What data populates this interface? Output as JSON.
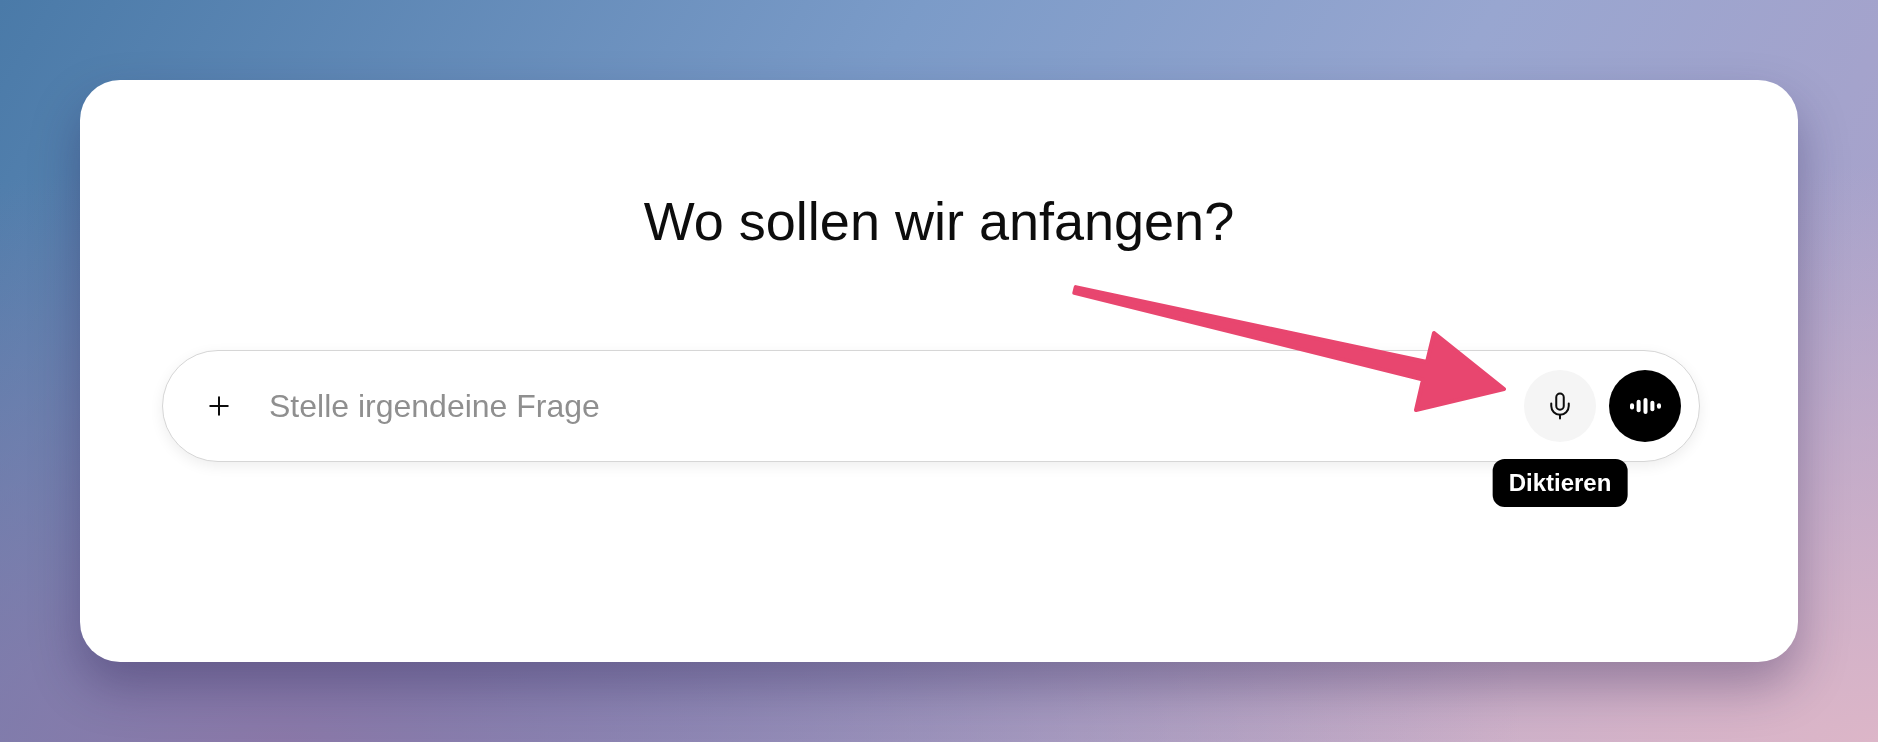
{
  "heading": "Wo sollen wir anfangen?",
  "composer": {
    "placeholder": "Stelle irgendeine Frage"
  },
  "tooltip": {
    "label": "Diktieren"
  }
}
